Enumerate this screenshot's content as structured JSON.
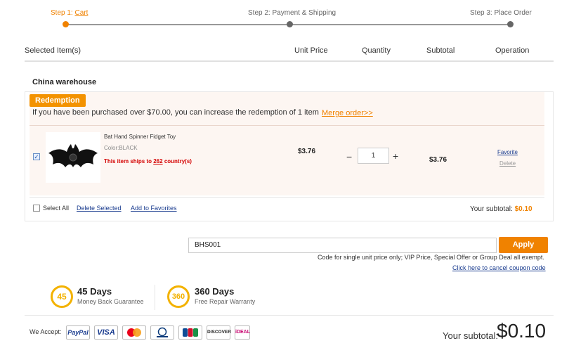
{
  "steps": {
    "step1_prefix": "Step 1: ",
    "step1_link": "Cart",
    "step2": "Step 2: Payment & Shipping",
    "step3": "Step 3: Place Order"
  },
  "columns": {
    "selected": "Selected Item(s)",
    "unit_price": "Unit Price",
    "quantity": "Quantity",
    "subtotal": "Subtotal",
    "operation": "Operation"
  },
  "warehouse": "China warehouse",
  "redemption": {
    "badge": "Redemption",
    "notice": "If you have been purchased over $70.00, you can increase the redemption of 1 item",
    "merge_link": "Merge order>>"
  },
  "item": {
    "title": "Bat Hand Spinner Fidget Toy",
    "color": "Color:BLACK",
    "ships_prefix": "This item ships to ",
    "ships_count": "262",
    "ships_suffix": " country(s)",
    "unit_price": "$3.76",
    "quantity": "1",
    "minus": "−",
    "plus": "+",
    "subtotal": "$3.76",
    "favorite": "Favorite",
    "delete": "Delete"
  },
  "footer": {
    "select_all": "Select All",
    "delete_selected": "Delete Selected",
    "add_favorites": "Add to Favorites",
    "your_subtotal_label": "Your subtotal: ",
    "your_subtotal_value": "$0.10"
  },
  "coupon": {
    "code": "BHS001",
    "apply": "Apply",
    "note": "Code for single unit price only; VIP Price, Special Offer or Group Deal all exempt.",
    "cancel_link": "Click here to cancel coupon code"
  },
  "guarantees": [
    {
      "icon": "45",
      "title": "45 Days",
      "sub": "Money Back Guarantee"
    },
    {
      "icon": "360",
      "title": "360 Days",
      "sub": "Free Repair Warranty"
    }
  ],
  "payments": {
    "label": "We Accept:",
    "methods": [
      "PayPal",
      "VISA",
      "MasterCard",
      "Diners Club",
      "JCB",
      "DISCOVER",
      "iDEAL"
    ]
  },
  "total": {
    "label": "Your subtotal:",
    "value": "$0.10"
  },
  "colors": {
    "accent": "#f08200",
    "link": "#1a3c8f",
    "alert": "#d40000"
  }
}
